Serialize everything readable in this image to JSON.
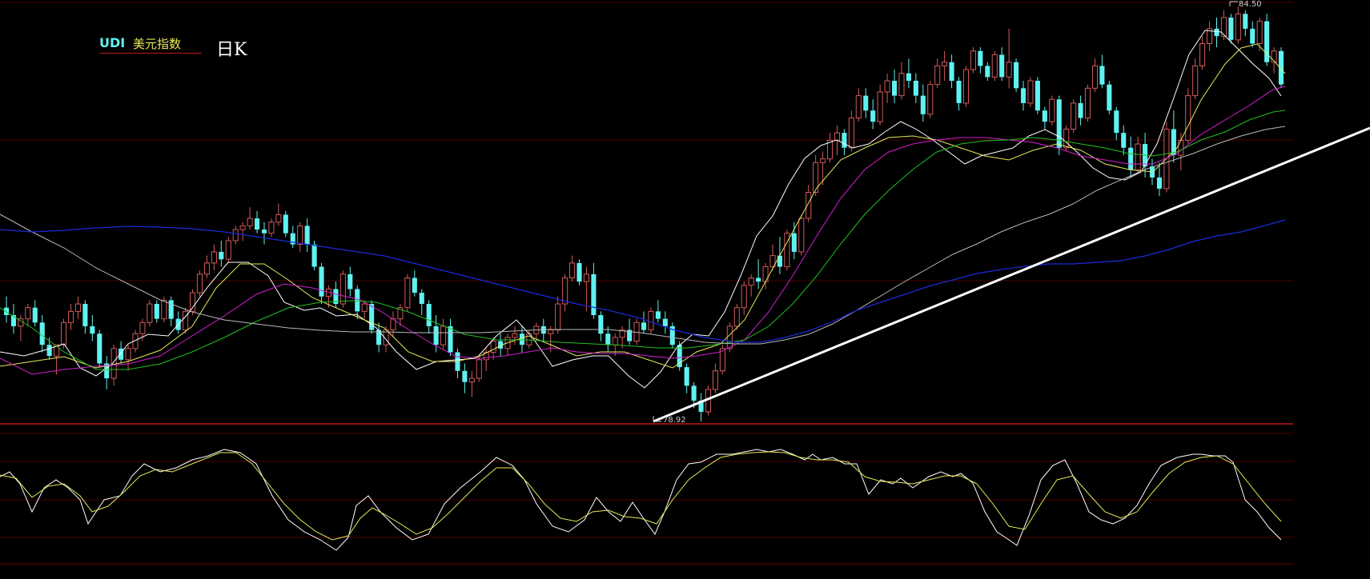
{
  "chart": {
    "symbol": "UDI",
    "name_cn": "美元指数",
    "period": "日K"
  },
  "chart_data": {
    "type": "candlestick",
    "x_axis": "trading days (time axis, not printed)",
    "price_labels": {
      "high": "84.50",
      "low": "78.92"
    },
    "candles": [
      [
        80.45,
        80.6,
        80.25,
        80.35
      ],
      [
        80.35,
        80.5,
        80.1,
        80.2
      ],
      [
        80.2,
        80.35,
        80.0,
        80.3
      ],
      [
        80.3,
        80.5,
        80.2,
        80.45
      ],
      [
        80.45,
        80.55,
        80.2,
        80.25
      ],
      [
        80.25,
        80.35,
        79.85,
        79.95
      ],
      [
        79.95,
        80.05,
        79.75,
        79.8
      ],
      [
        79.8,
        79.95,
        79.55,
        79.95
      ],
      [
        79.95,
        80.3,
        79.9,
        80.25
      ],
      [
        80.25,
        80.5,
        80.15,
        80.4
      ],
      [
        80.4,
        80.6,
        80.3,
        80.5
      ],
      [
        80.5,
        80.55,
        80.1,
        80.2
      ],
      [
        80.2,
        80.35,
        80.0,
        80.1
      ],
      [
        80.1,
        80.15,
        79.65,
        79.7
      ],
      [
        79.7,
        79.8,
        79.35,
        79.5
      ],
      [
        79.5,
        79.95,
        79.4,
        79.9
      ],
      [
        79.9,
        80.0,
        79.7,
        79.75
      ],
      [
        79.75,
        79.95,
        79.6,
        79.9
      ],
      [
        79.9,
        80.15,
        79.85,
        80.1
      ],
      [
        80.1,
        80.3,
        80.0,
        80.25
      ],
      [
        80.25,
        80.55,
        80.2,
        80.5
      ],
      [
        80.5,
        80.55,
        80.25,
        80.3
      ],
      [
        80.3,
        80.6,
        80.25,
        80.55
      ],
      [
        80.55,
        80.6,
        80.2,
        80.3
      ],
      [
        80.3,
        80.4,
        80.1,
        80.15
      ],
      [
        80.15,
        80.45,
        80.1,
        80.4
      ],
      [
        80.4,
        80.7,
        80.35,
        80.65
      ],
      [
        80.65,
        80.95,
        80.6,
        80.9
      ],
      [
        80.9,
        81.15,
        80.85,
        81.05
      ],
      [
        81.05,
        81.3,
        80.95,
        81.2
      ],
      [
        81.2,
        81.35,
        81.0,
        81.1
      ],
      [
        81.1,
        81.4,
        81.05,
        81.35
      ],
      [
        81.35,
        81.55,
        81.3,
        81.5
      ],
      [
        81.5,
        81.6,
        81.35,
        81.55
      ],
      [
        81.55,
        81.8,
        81.5,
        81.65
      ],
      [
        81.65,
        81.75,
        81.45,
        81.5
      ],
      [
        81.5,
        81.6,
        81.3,
        81.45
      ],
      [
        81.45,
        81.65,
        81.4,
        81.6
      ],
      [
        81.6,
        81.85,
        81.55,
        81.7
      ],
      [
        81.7,
        81.75,
        81.4,
        81.45
      ],
      [
        81.45,
        81.55,
        81.25,
        81.3
      ],
      [
        81.3,
        81.6,
        81.2,
        81.55
      ],
      [
        81.55,
        81.65,
        81.2,
        81.3
      ],
      [
        81.3,
        81.35,
        80.95,
        81.0
      ],
      [
        81.0,
        81.05,
        80.5,
        80.6
      ],
      [
        80.6,
        80.75,
        80.45,
        80.7
      ],
      [
        80.7,
        80.8,
        80.45,
        80.5
      ],
      [
        80.5,
        80.95,
        80.45,
        80.9
      ],
      [
        80.9,
        81.0,
        80.6,
        80.7
      ],
      [
        80.7,
        80.75,
        80.3,
        80.4
      ],
      [
        80.4,
        80.55,
        80.3,
        80.5
      ],
      [
        80.5,
        80.55,
        80.1,
        80.15
      ],
      [
        80.15,
        80.25,
        79.85,
        79.95
      ],
      [
        79.95,
        80.2,
        79.85,
        80.15
      ],
      [
        80.15,
        80.4,
        80.05,
        80.3
      ],
      [
        80.3,
        80.5,
        80.2,
        80.45
      ],
      [
        80.45,
        80.9,
        80.4,
        80.85
      ],
      [
        80.85,
        80.95,
        80.6,
        80.65
      ],
      [
        80.65,
        80.7,
        80.35,
        80.5
      ],
      [
        80.5,
        80.55,
        80.1,
        80.2
      ],
      [
        80.2,
        80.35,
        79.85,
        79.95
      ],
      [
        79.95,
        80.3,
        79.9,
        80.2
      ],
      [
        80.2,
        80.3,
        79.8,
        79.85
      ],
      [
        79.85,
        79.9,
        79.5,
        79.6
      ],
      [
        79.6,
        79.7,
        79.3,
        79.45
      ],
      [
        79.45,
        79.6,
        79.25,
        79.5
      ],
      [
        79.5,
        79.8,
        79.45,
        79.75
      ],
      [
        79.75,
        79.9,
        79.6,
        79.85
      ],
      [
        79.85,
        80.05,
        79.75,
        80.0
      ],
      [
        80.0,
        80.1,
        79.8,
        79.9
      ],
      [
        79.9,
        80.1,
        79.8,
        80.05
      ],
      [
        80.05,
        80.2,
        79.95,
        80.1
      ],
      [
        80.1,
        80.2,
        79.85,
        79.95
      ],
      [
        79.95,
        80.15,
        79.9,
        80.1
      ],
      [
        80.1,
        80.25,
        80.0,
        80.2
      ],
      [
        80.2,
        80.3,
        80.0,
        80.1
      ],
      [
        80.1,
        80.2,
        79.85,
        80.15
      ],
      [
        80.15,
        80.6,
        80.1,
        80.5
      ],
      [
        80.5,
        80.9,
        80.4,
        80.85
      ],
      [
        80.85,
        81.15,
        80.8,
        81.05
      ],
      [
        81.05,
        81.1,
        80.75,
        80.8
      ],
      [
        80.8,
        81.0,
        80.4,
        80.9
      ],
      [
        80.9,
        81.05,
        80.3,
        80.35
      ],
      [
        80.35,
        80.4,
        80.0,
        80.1
      ],
      [
        80.1,
        80.2,
        79.85,
        79.95
      ],
      [
        79.95,
        80.1,
        79.8,
        80.05
      ],
      [
        80.05,
        80.2,
        79.9,
        80.15
      ],
      [
        80.15,
        80.3,
        79.95,
        80.0
      ],
      [
        80.0,
        80.3,
        79.95,
        80.25
      ],
      [
        80.25,
        80.4,
        80.1,
        80.15
      ],
      [
        80.15,
        80.45,
        80.1,
        80.4
      ],
      [
        80.4,
        80.55,
        80.25,
        80.3
      ],
      [
        80.3,
        80.4,
        80.1,
        80.2
      ],
      [
        80.2,
        80.25,
        79.9,
        79.95
      ],
      [
        79.95,
        80.0,
        79.6,
        79.65
      ],
      [
        79.65,
        79.7,
        79.3,
        79.4
      ],
      [
        79.4,
        79.45,
        79.1,
        79.2
      ],
      [
        79.2,
        79.3,
        78.92,
        79.05
      ],
      [
        79.05,
        79.4,
        79.0,
        79.35
      ],
      [
        79.35,
        79.7,
        79.3,
        79.6
      ],
      [
        79.6,
        79.95,
        79.55,
        79.9
      ],
      [
        79.9,
        80.25,
        79.85,
        80.2
      ],
      [
        80.2,
        80.5,
        80.15,
        80.45
      ],
      [
        80.45,
        80.8,
        80.35,
        80.75
      ],
      [
        80.75,
        80.9,
        80.6,
        80.85
      ],
      [
        80.85,
        81.1,
        80.7,
        80.8
      ],
      [
        80.8,
        81.05,
        80.7,
        81.0
      ],
      [
        81.0,
        81.3,
        80.95,
        81.15
      ],
      [
        81.15,
        81.4,
        80.9,
        81.0
      ],
      [
        81.0,
        81.5,
        80.95,
        81.45
      ],
      [
        81.45,
        81.6,
        81.1,
        81.2
      ],
      [
        81.2,
        81.7,
        81.15,
        81.65
      ],
      [
        81.65,
        82.1,
        81.6,
        82.0
      ],
      [
        82.0,
        82.5,
        81.95,
        82.4
      ],
      [
        82.4,
        82.55,
        82.1,
        82.45
      ],
      [
        82.45,
        82.8,
        82.4,
        82.7
      ],
      [
        82.7,
        82.9,
        82.5,
        82.8
      ],
      [
        82.8,
        82.85,
        82.5,
        82.6
      ],
      [
        82.6,
        83.1,
        82.55,
        83.0
      ],
      [
        83.0,
        83.4,
        82.95,
        83.3
      ],
      [
        83.3,
        83.4,
        83.0,
        83.1
      ],
      [
        83.1,
        83.25,
        82.85,
        82.95
      ],
      [
        82.95,
        83.45,
        82.9,
        83.35
      ],
      [
        83.35,
        83.6,
        83.2,
        83.5
      ],
      [
        83.5,
        83.65,
        83.2,
        83.3
      ],
      [
        83.3,
        83.75,
        83.25,
        83.6
      ],
      [
        83.6,
        83.8,
        83.4,
        83.5
      ],
      [
        83.5,
        83.6,
        83.2,
        83.3
      ],
      [
        83.3,
        83.45,
        82.95,
        83.05
      ],
      [
        83.05,
        83.5,
        83.0,
        83.45
      ],
      [
        83.45,
        83.8,
        83.4,
        83.7
      ],
      [
        83.7,
        83.9,
        83.5,
        83.75
      ],
      [
        83.75,
        83.85,
        83.4,
        83.5
      ],
      [
        83.5,
        83.55,
        83.1,
        83.2
      ],
      [
        83.2,
        83.7,
        83.15,
        83.65
      ],
      [
        83.65,
        83.95,
        83.6,
        83.9
      ],
      [
        83.9,
        83.95,
        83.6,
        83.7
      ],
      [
        83.7,
        83.75,
        83.5,
        83.55
      ],
      [
        83.55,
        83.9,
        83.5,
        83.85
      ],
      [
        83.85,
        83.95,
        83.5,
        83.55
      ],
      [
        83.55,
        84.2,
        83.4,
        83.75
      ],
      [
        83.75,
        83.8,
        83.35,
        83.4
      ],
      [
        83.4,
        83.5,
        83.1,
        83.2
      ],
      [
        83.2,
        83.55,
        83.15,
        83.5
      ],
      [
        83.5,
        83.55,
        83.05,
        83.1
      ],
      [
        83.1,
        83.15,
        82.85,
        82.95
      ],
      [
        82.95,
        83.3,
        82.9,
        83.25
      ],
      [
        83.25,
        83.3,
        82.5,
        82.6
      ],
      [
        82.6,
        82.9,
        82.55,
        82.85
      ],
      [
        82.85,
        83.25,
        82.8,
        83.2
      ],
      [
        83.2,
        83.3,
        82.9,
        83.0
      ],
      [
        83.0,
        83.45,
        82.95,
        83.4
      ],
      [
        83.4,
        83.8,
        83.35,
        83.7
      ],
      [
        83.7,
        83.85,
        83.4,
        83.45
      ],
      [
        83.45,
        83.5,
        83.05,
        83.1
      ],
      [
        83.1,
        83.15,
        82.7,
        82.8
      ],
      [
        82.8,
        82.9,
        82.5,
        82.6
      ],
      [
        82.6,
        82.75,
        82.2,
        82.3
      ],
      [
        82.3,
        82.75,
        82.25,
        82.65
      ],
      [
        82.65,
        82.8,
        82.2,
        82.35
      ],
      [
        82.35,
        82.45,
        82.1,
        82.2
      ],
      [
        82.2,
        82.4,
        81.95,
        82.05
      ],
      [
        82.05,
        82.95,
        82.0,
        82.85
      ],
      [
        82.85,
        83.1,
        82.4,
        82.5
      ],
      [
        82.5,
        82.8,
        82.3,
        82.7
      ],
      [
        82.7,
        83.4,
        82.65,
        83.3
      ],
      [
        83.3,
        83.8,
        83.25,
        83.7
      ],
      [
        83.7,
        84.1,
        83.65,
        84.0
      ],
      [
        84.0,
        84.3,
        83.9,
        84.2
      ],
      [
        84.2,
        84.35,
        83.95,
        84.1
      ],
      [
        84.1,
        84.45,
        84.05,
        84.35
      ],
      [
        84.35,
        84.4,
        84.0,
        84.05
      ],
      [
        84.05,
        84.5,
        84.0,
        84.4
      ],
      [
        84.4,
        84.45,
        84.1,
        84.2
      ],
      [
        84.2,
        84.3,
        83.95,
        84.0
      ],
      [
        84.0,
        84.35,
        83.9,
        84.3
      ],
      [
        84.3,
        84.4,
        83.7,
        83.75
      ],
      [
        83.75,
        83.95,
        83.6,
        83.9
      ],
      [
        83.9,
        83.95,
        83.4,
        83.45
      ]
    ]
  }
}
